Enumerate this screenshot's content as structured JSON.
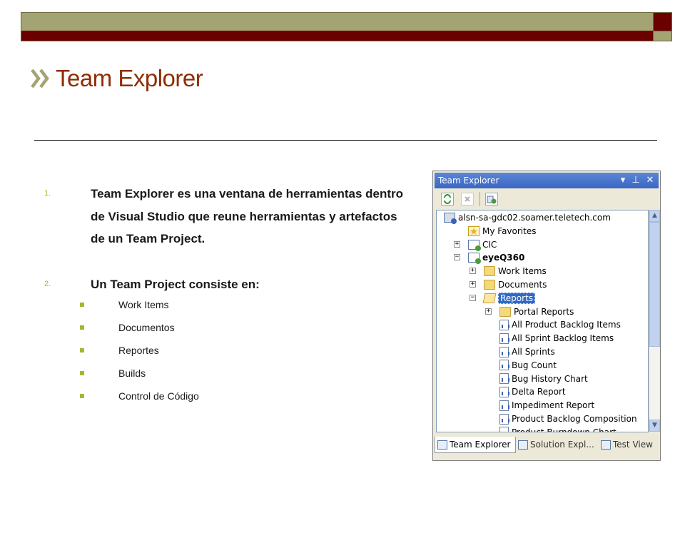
{
  "slide": {
    "title": "Team Explorer",
    "colors": {
      "title": "#8f2d04",
      "accent": "#9cbb2f",
      "bar_olive": "#a3a374",
      "bar_maroon": "#6a0000"
    },
    "numbered_items": [
      {
        "marker": "1.",
        "text": "Team Explorer  es una ventana de herramientas dentro de Visual Studio que reune herramientas y artefactos de un Team Project."
      },
      {
        "marker": "2.",
        "text": "Un Team Project consiste en:"
      }
    ],
    "bullets": [
      "Work Items",
      "Documentos",
      "Reportes",
      "Builds",
      "Control de  Código"
    ]
  },
  "window": {
    "title": "Team Explorer",
    "title_buttons": [
      "chevron-down-icon",
      "pin-icon",
      "close-icon"
    ],
    "toolbar": [
      "refresh-icon",
      "stop-icon",
      "add-project-icon"
    ],
    "tree": [
      {
        "label": "alsn-sa-gdc02.soamer.teletech.com",
        "icon": "server-icon",
        "depth": 0,
        "expander": ""
      },
      {
        "label": "My Favorites",
        "icon": "star-icon",
        "depth": 1,
        "expander": ""
      },
      {
        "label": "CIC",
        "icon": "project-icon",
        "depth": 1,
        "expander": "+"
      },
      {
        "label": "eyeQ360",
        "icon": "project-icon",
        "depth": 1,
        "expander": "-",
        "bold": true
      },
      {
        "label": "Work Items",
        "icon": "folder-icon",
        "depth": 2,
        "expander": "+"
      },
      {
        "label": "Documents",
        "icon": "folder-icon",
        "depth": 2,
        "expander": "+"
      },
      {
        "label": "Reports",
        "icon": "folder-open-icon",
        "depth": 2,
        "expander": "-",
        "selected": true
      },
      {
        "label": "Portal Reports",
        "icon": "folder-icon",
        "depth": 3,
        "expander": "+"
      },
      {
        "label": "All Product Backlog Items",
        "icon": "report-icon",
        "depth": 3,
        "expander": ""
      },
      {
        "label": "All Sprint Backlog Items",
        "icon": "report-icon",
        "depth": 3,
        "expander": ""
      },
      {
        "label": "All Sprints",
        "icon": "report-icon",
        "depth": 3,
        "expander": ""
      },
      {
        "label": "Bug Count",
        "icon": "report-icon",
        "depth": 3,
        "expander": ""
      },
      {
        "label": "Bug History Chart",
        "icon": "report-icon",
        "depth": 3,
        "expander": ""
      },
      {
        "label": "Delta Report",
        "icon": "report-icon",
        "depth": 3,
        "expander": ""
      },
      {
        "label": "Impediment Report",
        "icon": "report-icon",
        "depth": 3,
        "expander": ""
      },
      {
        "label": "Product Backlog Composition",
        "icon": "report-icon",
        "depth": 3,
        "expander": ""
      },
      {
        "label": "Product Burndown Chart",
        "icon": "report-icon",
        "depth": 3,
        "expander": ""
      }
    ],
    "tabs": [
      {
        "label": "Team Explorer",
        "active": true
      },
      {
        "label": "Solution Expl...",
        "active": false
      },
      {
        "label": "Test View",
        "active": false
      }
    ]
  }
}
